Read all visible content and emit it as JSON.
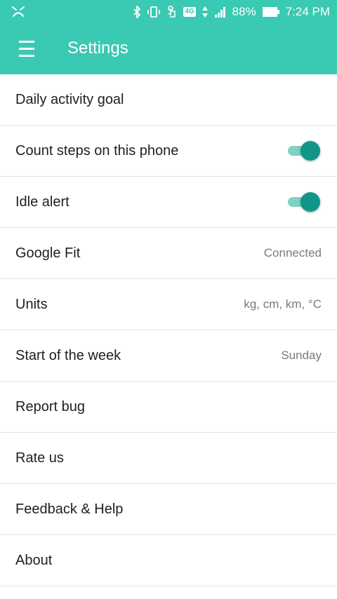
{
  "status_bar": {
    "network": "4G",
    "battery": "88%",
    "time": "7:24 PM"
  },
  "toolbar": {
    "title": "Settings"
  },
  "colors": {
    "accent": "#3ac9b2",
    "toggle_on": "#0f9688"
  },
  "settings": [
    {
      "label": "Daily activity goal"
    },
    {
      "label": "Count steps on this phone",
      "toggle": true
    },
    {
      "label": "Idle alert",
      "toggle": true
    },
    {
      "label": "Google Fit",
      "value": "Connected"
    },
    {
      "label": "Units",
      "value": "kg, cm, km, °C"
    },
    {
      "label": "Start of the week",
      "value": "Sunday"
    },
    {
      "label": "Report bug"
    },
    {
      "label": "Rate us"
    },
    {
      "label": "Feedback & Help"
    },
    {
      "label": "About"
    }
  ]
}
